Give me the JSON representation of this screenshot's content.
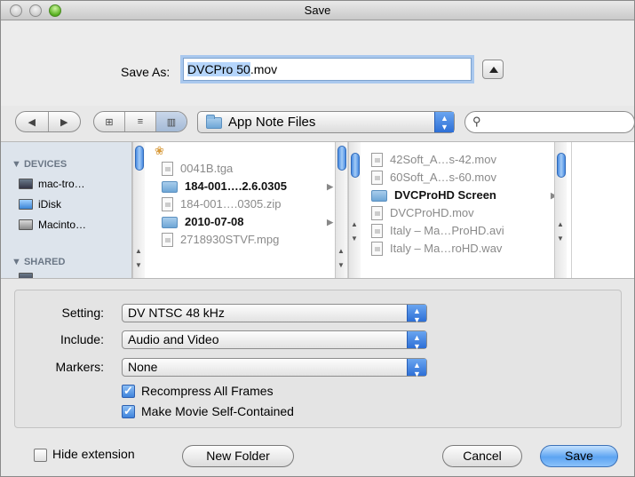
{
  "window": {
    "title": "Save"
  },
  "save_as": {
    "label": "Save As:",
    "value_selected": "DVCPro 50",
    "value_rest": ".mov"
  },
  "location": {
    "folder": "App Note Files"
  },
  "sidebar": {
    "devices_header": "DEVICES",
    "devices": [
      "mac-tro…",
      "iDisk",
      "Macinto…"
    ],
    "shared_header": "SHARED"
  },
  "column1": [
    {
      "name": "0041B.tga",
      "kind": "file",
      "dim": true
    },
    {
      "name": "184-001….2.6.0305",
      "kind": "folder",
      "dim": false
    },
    {
      "name": "184-001….0305.zip",
      "kind": "file",
      "dim": true
    },
    {
      "name": "2010-07-08",
      "kind": "folder",
      "dim": false
    },
    {
      "name": "2718930STVF.mpg",
      "kind": "file",
      "dim": true
    }
  ],
  "column2": [
    {
      "name": "42Soft_A…s-42.mov",
      "kind": "file",
      "dim": true
    },
    {
      "name": "60Soft_A…s-60.mov",
      "kind": "file",
      "dim": true
    },
    {
      "name": "DVCProHD Screen",
      "kind": "folder",
      "dim": false
    },
    {
      "name": "DVCProHD.mov",
      "kind": "file",
      "dim": true
    },
    {
      "name": "Italy – Ma…ProHD.avi",
      "kind": "file",
      "dim": true
    },
    {
      "name": "Italy – Ma…roHD.wav",
      "kind": "file",
      "dim": true
    }
  ],
  "options": {
    "setting_label": "Setting:",
    "setting_value": "DV NTSC 48 kHz",
    "include_label": "Include:",
    "include_value": "Audio and Video",
    "markers_label": "Markers:",
    "markers_value": "None",
    "recompress_label": "Recompress All Frames",
    "recompress_checked": true,
    "selfcontained_label": "Make Movie Self-Contained",
    "selfcontained_checked": true
  },
  "bottom": {
    "hide_extension_label": "Hide extension",
    "new_folder_label": "New Folder",
    "cancel_label": "Cancel",
    "save_label": "Save"
  }
}
